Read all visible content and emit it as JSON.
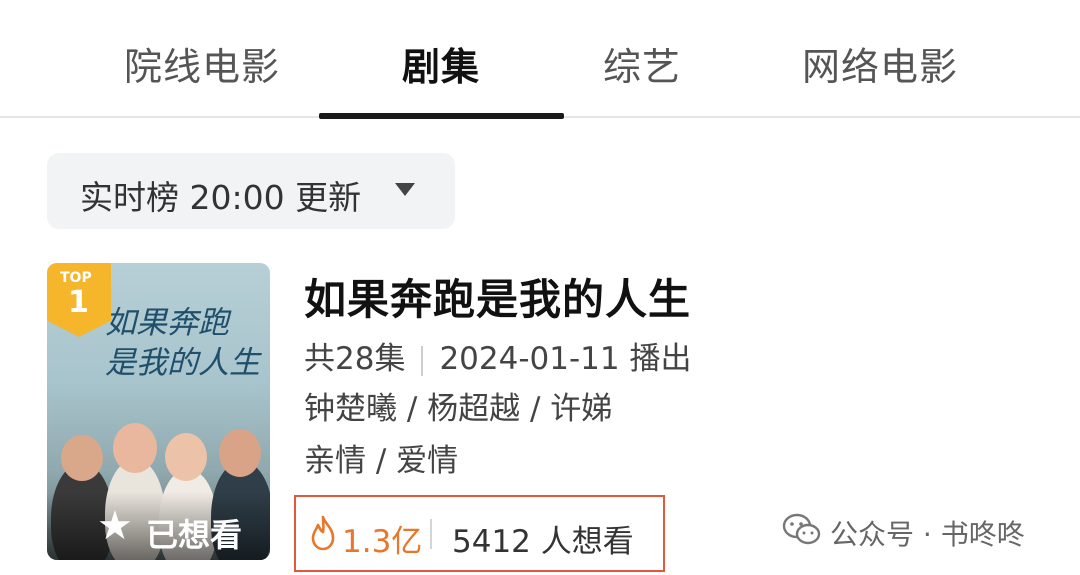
{
  "tabs": [
    {
      "label": "院线电影",
      "active": false
    },
    {
      "label": "剧集",
      "active": true
    },
    {
      "label": "综艺",
      "active": false
    },
    {
      "label": "网络电影",
      "active": false
    }
  ],
  "filter": {
    "label": "实时榜 20:00 更新",
    "icon": "caret-down-icon"
  },
  "item": {
    "rank_badge": {
      "top_label": "TOP",
      "number": "1"
    },
    "poster_title": "如果奔跑\n是我的人生",
    "poster_status": {
      "icon": "star-icon",
      "label": "已想看"
    },
    "title": "如果奔跑是我的人生",
    "episodes": "共28集",
    "air_date": "2024-01-11 播出",
    "cast": "钟楚曦 / 杨超越 / 许娣",
    "genres": "亲情 / 爱情",
    "heat": {
      "icon": "fire-icon",
      "value": "1.3亿"
    },
    "want_count": "5412 人想看"
  },
  "watermark": {
    "icon": "wechat-icon",
    "text": "公众号 · 书咚咚"
  },
  "colors": {
    "accent_orange": "#e8762b",
    "highlight_border": "#e0593a",
    "badge": "#f5b62c",
    "active_tab": "#111111"
  }
}
